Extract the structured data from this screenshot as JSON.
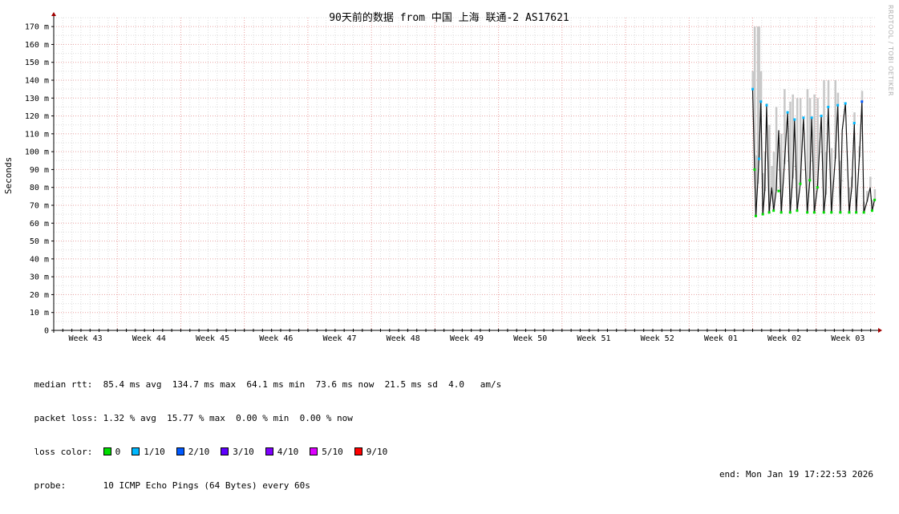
{
  "chart_data": {
    "type": "line",
    "title": "90天前的数据 from 中国 上海 联通-2 AS17621",
    "ylabel": "Seconds",
    "ylim": [
      0,
      175
    ],
    "y_ticks": [
      {
        "value": 0,
        "label": "0"
      },
      {
        "value": 10,
        "label": "10 m"
      },
      {
        "value": 20,
        "label": "20 m"
      },
      {
        "value": 30,
        "label": "30 m"
      },
      {
        "value": 40,
        "label": "40 m"
      },
      {
        "value": 50,
        "label": "50 m"
      },
      {
        "value": 60,
        "label": "60 m"
      },
      {
        "value": 70,
        "label": "70 m"
      },
      {
        "value": 80,
        "label": "80 m"
      },
      {
        "value": 90,
        "label": "90 m"
      },
      {
        "value": 100,
        "label": "100 m"
      },
      {
        "value": 110,
        "label": "110 m"
      },
      {
        "value": 120,
        "label": "120 m"
      },
      {
        "value": 130,
        "label": "130 m"
      },
      {
        "value": 140,
        "label": "140 m"
      },
      {
        "value": 150,
        "label": "150 m"
      },
      {
        "value": 160,
        "label": "160 m"
      },
      {
        "value": 170,
        "label": "170 m"
      }
    ],
    "x_domain": [
      0,
      12.95
    ],
    "week_ticks": [
      "Week 43",
      "Week 44",
      "Week 45",
      "Week 46",
      "Week 47",
      "Week 48",
      "Week 49",
      "Week 50",
      "Week 51",
      "Week 52",
      "Week 01",
      "Week 02",
      "Week 03"
    ],
    "grid": true,
    "series": [
      {
        "x": [
          11.0,
          11.03,
          11.05,
          11.08,
          11.1,
          11.13,
          11.16,
          11.19,
          11.22,
          11.26,
          11.3,
          11.33,
          11.37,
          11.41,
          11.45,
          11.5,
          11.55,
          11.59,
          11.63,
          11.66,
          11.7,
          11.75,
          11.8,
          11.86,
          11.9,
          11.93,
          11.97,
          12.02,
          12.08,
          12.12,
          12.15,
          12.19,
          12.24,
          12.3,
          12.34,
          12.38,
          12.41,
          12.46,
          12.52,
          12.56,
          12.6,
          12.63,
          12.68,
          12.72,
          12.75,
          12.8,
          12.85,
          12.88,
          12.92
        ],
        "values": [
          135,
          90,
          64,
          82,
          96,
          128,
          65,
          78,
          126,
          66,
          80,
          67,
          78,
          112,
          66,
          93,
          122,
          66,
          85,
          118,
          67,
          82,
          119,
          66,
          84,
          119,
          66,
          80,
          120,
          66,
          76,
          125,
          66,
          96,
          126,
          66,
          112,
          127,
          66,
          80,
          116,
          66,
          97,
          128,
          66,
          72,
          80,
          67,
          73
        ],
        "max": [
          145,
          170,
          98,
          170,
          170,
          145,
          88,
          100,
          127,
          115,
          92,
          100,
          125,
          90,
          110,
          135,
          95,
          128,
          132,
          92,
          130,
          130,
          90,
          135,
          130,
          95,
          132,
          130,
          100,
          140,
          100,
          140,
          102,
          140,
          133,
          95,
          84,
          90,
          80
        ]
      }
    ],
    "loss_markers": {
      "colors": {
        "0": "#00dd00",
        "1/10": "#00b8ff",
        "2/10": "#0059ff",
        "3/10": "#5e00ff",
        "4/10": "#7e00ff",
        "5/10": "#dd00ff",
        "9/10": "#ff0000"
      },
      "points": [
        {
          "x": 11.0,
          "value": 135,
          "loss": "1/10"
        },
        {
          "x": 11.1,
          "value": 96,
          "loss": "1/10"
        },
        {
          "x": 11.13,
          "value": 128,
          "loss": "1/10"
        },
        {
          "x": 11.22,
          "value": 126,
          "loss": "1/10"
        },
        {
          "x": 11.45,
          "value": 66,
          "loss": "0"
        },
        {
          "x": 11.55,
          "value": 122,
          "loss": "1/10"
        },
        {
          "x": 11.66,
          "value": 118,
          "loss": "1/10"
        },
        {
          "x": 11.8,
          "value": 119,
          "loss": "1/10"
        },
        {
          "x": 11.93,
          "value": 119,
          "loss": "1/10"
        },
        {
          "x": 12.08,
          "value": 120,
          "loss": "1/10"
        },
        {
          "x": 12.19,
          "value": 125,
          "loss": "1/10"
        },
        {
          "x": 12.34,
          "value": 126,
          "loss": "1/10"
        },
        {
          "x": 12.46,
          "value": 127,
          "loss": "1/10"
        },
        {
          "x": 12.6,
          "value": 116,
          "loss": "1/10"
        },
        {
          "x": 12.72,
          "value": 128,
          "loss": "2/10"
        },
        {
          "x": 11.03,
          "value": 90,
          "loss": "0"
        },
        {
          "x": 11.05,
          "value": 64,
          "loss": "0"
        },
        {
          "x": 11.16,
          "value": 65,
          "loss": "0"
        },
        {
          "x": 11.26,
          "value": 66,
          "loss": "0"
        },
        {
          "x": 11.33,
          "value": 67,
          "loss": "0"
        },
        {
          "x": 11.59,
          "value": 66,
          "loss": "0"
        },
        {
          "x": 11.7,
          "value": 67,
          "loss": "0"
        },
        {
          "x": 11.86,
          "value": 66,
          "loss": "0"
        },
        {
          "x": 11.97,
          "value": 66,
          "loss": "0"
        },
        {
          "x": 12.12,
          "value": 66,
          "loss": "0"
        },
        {
          "x": 12.24,
          "value": 66,
          "loss": "0"
        },
        {
          "x": 12.38,
          "value": 66,
          "loss": "0"
        },
        {
          "x": 12.52,
          "value": 66,
          "loss": "0"
        },
        {
          "x": 12.63,
          "value": 66,
          "loss": "0"
        },
        {
          "x": 12.75,
          "value": 66,
          "loss": "0"
        },
        {
          "x": 12.88,
          "value": 67,
          "loss": "0"
        },
        {
          "x": 12.92,
          "value": 73,
          "loss": "0"
        },
        {
          "x": 11.41,
          "value": 78,
          "loss": "0"
        },
        {
          "x": 11.75,
          "value": 82,
          "loss": "0"
        },
        {
          "x": 11.9,
          "value": 84,
          "loss": "0"
        },
        {
          "x": 12.02,
          "value": 80,
          "loss": "0"
        }
      ]
    }
  },
  "vendor_label": "RRDTOOL / TOBI OETIKER",
  "stats": {
    "median": {
      "label": "median rtt:",
      "text": "  85.4 ms avg  134.7 ms max  64.1 ms min  73.6 ms now  21.5 ms sd  4.0   am/s"
    },
    "loss": {
      "label": "packet loss:",
      "text": " 1.32 % avg  15.77 % max  0.00 % min  0.00 % now"
    },
    "loss_color_label": "loss color:",
    "loss_legend": [
      {
        "label": "0",
        "color": "#00dd00"
      },
      {
        "label": "1/10",
        "color": "#00b8ff"
      },
      {
        "label": "2/10",
        "color": "#0059ff"
      },
      {
        "label": "3/10",
        "color": "#5e00ff"
      },
      {
        "label": "4/10",
        "color": "#7e00ff"
      },
      {
        "label": "5/10",
        "color": "#dd00ff"
      },
      {
        "label": "9/10",
        "color": "#ff0000"
      }
    ],
    "probe": {
      "label": "probe:",
      "text": "       10 ICMP Echo Pings (64 Bytes) every 60s"
    },
    "end": "end: Mon Jan 19 17:22:53 2026"
  }
}
